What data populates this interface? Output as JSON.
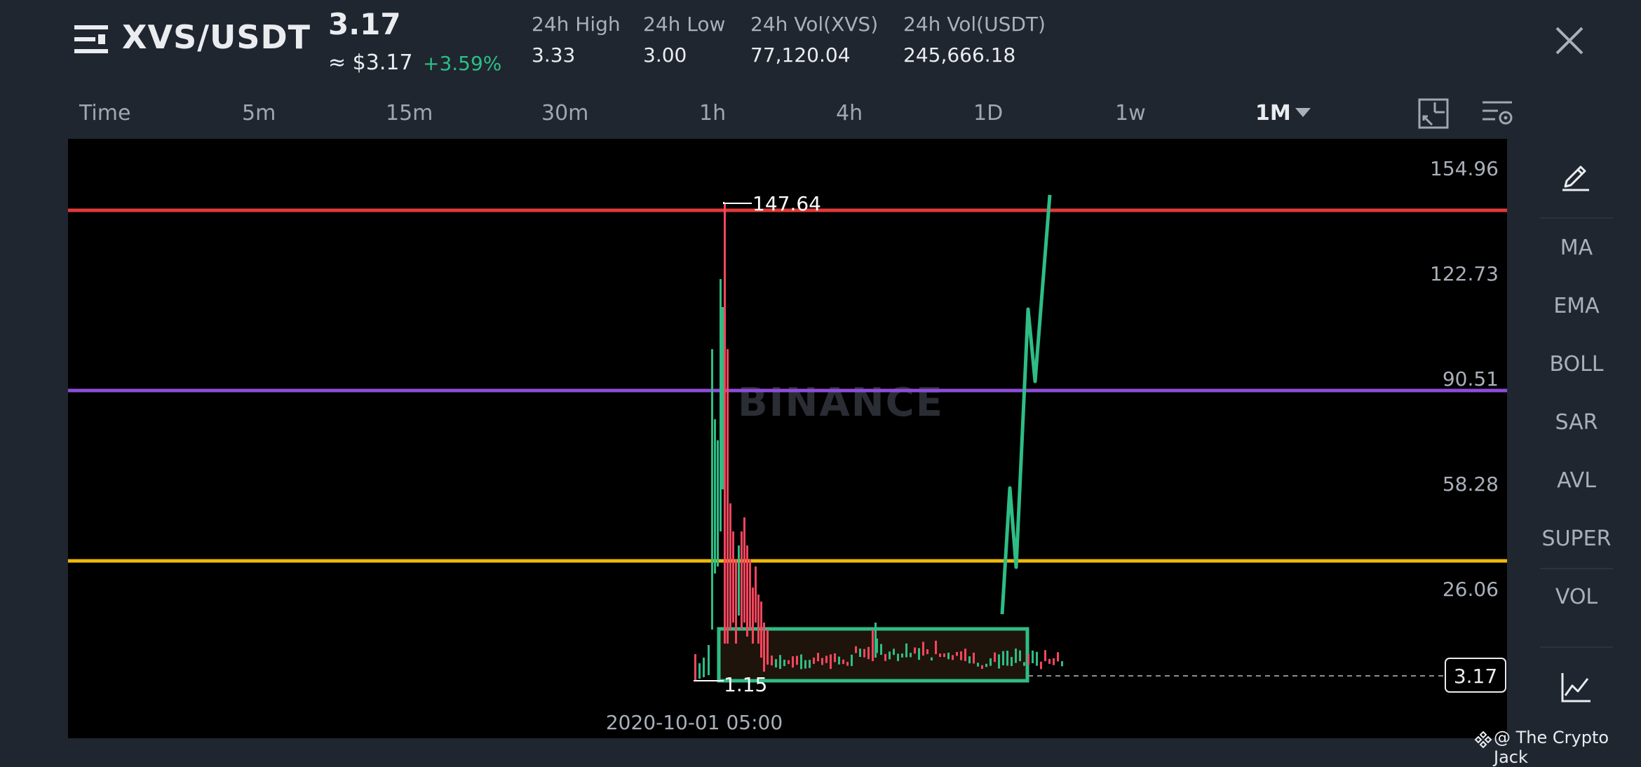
{
  "header": {
    "pair": "XVS/USDT",
    "price": "3.17",
    "usd_price": "≈ $3.17",
    "change": "+3.59%",
    "stats": [
      {
        "label": "24h High",
        "value": "3.33"
      },
      {
        "label": "24h Low",
        "value": "3.00"
      },
      {
        "label": "24h Vol(XVS)",
        "value": "77,120.04"
      },
      {
        "label": "24h Vol(USDT)",
        "value": "245,666.18"
      }
    ]
  },
  "timeframes": [
    "Time",
    "5m",
    "15m",
    "30m",
    "1h",
    "4h",
    "1D",
    "1w",
    "1M"
  ],
  "active_timeframe": "1M",
  "chart": {
    "y_ticks": [
      "154.96",
      "122.73",
      "90.51",
      "58.28",
      "26.06"
    ],
    "high_label": "147.64",
    "low_label": "1.15",
    "current_price": "3.17",
    "date_label": "2020-10-01 05:00",
    "watermark": "BINANCE",
    "colors": {
      "up": "#2ebd85",
      "down": "#f6465d",
      "red_line": "#e03a3a",
      "purple_line": "#8e4dd9",
      "yellow_line": "#f0b90b"
    }
  },
  "indicators": [
    "MA",
    "EMA",
    "BOLL",
    "SAR",
    "AVL",
    "SUPER",
    "VOL"
  ],
  "credit": "@ The Crypto Jack",
  "icons": {
    "menu": "menu-icon",
    "close": "close-icon",
    "edit": "pencil-icon",
    "chart_type": "line-chart-icon"
  }
}
